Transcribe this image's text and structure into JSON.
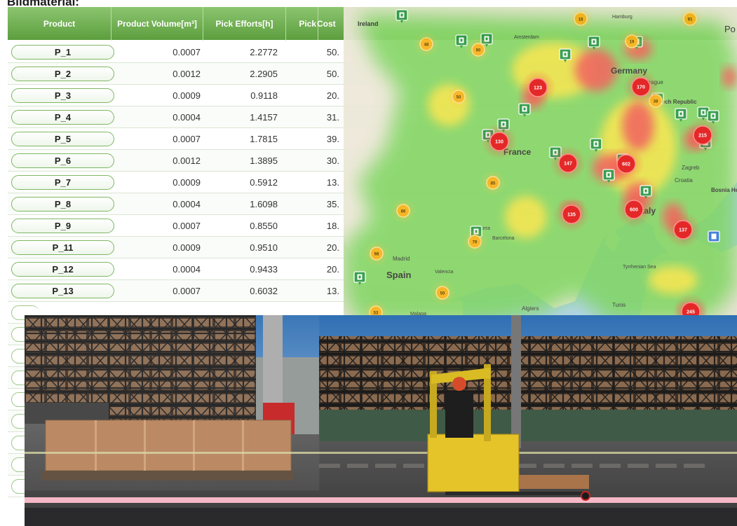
{
  "page": {
    "title": "Bildmaterial:"
  },
  "table": {
    "headers": [
      "Product",
      "Product Volume[m³]",
      "Pick Efforts[h]",
      "Pick",
      "Cost"
    ],
    "rows": [
      {
        "product": "P_1",
        "volume": "0.0007",
        "effort": "2.2772",
        "cost": "50."
      },
      {
        "product": "P_2",
        "volume": "0.0012",
        "effort": "2.2905",
        "cost": "50."
      },
      {
        "product": "P_3",
        "volume": "0.0009",
        "effort": "0.9118",
        "cost": "20."
      },
      {
        "product": "P_4",
        "volume": "0.0004",
        "effort": "1.4157",
        "cost": "31."
      },
      {
        "product": "P_5",
        "volume": "0.0007",
        "effort": "1.7815",
        "cost": "39."
      },
      {
        "product": "P_6",
        "volume": "0.0012",
        "effort": "1.3895",
        "cost": "30."
      },
      {
        "product": "P_7",
        "volume": "0.0009",
        "effort": "0.5912",
        "cost": "13."
      },
      {
        "product": "P_8",
        "volume": "0.0004",
        "effort": "1.6098",
        "cost": "35."
      },
      {
        "product": "P_9",
        "volume": "0.0007",
        "effort": "0.8550",
        "cost": "18."
      },
      {
        "product": "P_11",
        "volume": "0.0009",
        "effort": "0.9510",
        "cost": "20."
      },
      {
        "product": "P_12",
        "volume": "0.0004",
        "effort": "0.9433",
        "cost": "20."
      },
      {
        "product": "P_13",
        "volume": "0.0007",
        "effort": "0.6032",
        "cost": "13."
      }
    ],
    "empty_rows": 9,
    "colors": {
      "header": "#6aaa4b",
      "pill_border": "#7fb764"
    }
  },
  "map": {
    "labels": {
      "ireland": "Ireland",
      "germany": "Germany",
      "france": "France",
      "spain": "Spain",
      "italy": "Italy",
      "barcelona": "Barcelona",
      "prague": "Prague",
      "czech": "Czech Republic",
      "zagreb": "Zagreb",
      "croatia": "Croatia",
      "bosnia": "Bosnia Herzego",
      "tunis": "Tunis",
      "algiers": "Algiers",
      "malaga": "Malaga",
      "valencia": "Valencia",
      "madrid": "Madrid",
      "amsterdam": "Amsterdam",
      "hamburg": "Hamburg",
      "tyrrhenian": "Tyrrhenian Sea",
      "andorra": "Andorra",
      "po": "Po"
    },
    "clusters": [
      {
        "value": "48",
        "level": "orange"
      },
      {
        "value": "90",
        "level": "orange"
      },
      {
        "value": "18",
        "level": "orange"
      },
      {
        "value": "19",
        "level": "orange"
      },
      {
        "value": "91",
        "level": "orange"
      },
      {
        "value": "50",
        "level": "orange"
      },
      {
        "value": "38",
        "level": "orange"
      },
      {
        "value": "85",
        "level": "orange"
      },
      {
        "value": "86",
        "level": "orange"
      },
      {
        "value": "79",
        "level": "orange"
      },
      {
        "value": "98",
        "level": "orange"
      },
      {
        "value": "50",
        "level": "orange"
      },
      {
        "value": "53",
        "level": "orange"
      },
      {
        "value": "123",
        "level": "red"
      },
      {
        "value": "170",
        "level": "red"
      },
      {
        "value": "215",
        "level": "red"
      },
      {
        "value": "130",
        "level": "red"
      },
      {
        "value": "147",
        "level": "red"
      },
      {
        "value": "602",
        "level": "red"
      },
      {
        "value": "135",
        "level": "red"
      },
      {
        "value": "600",
        "level": "red"
      },
      {
        "value": "137",
        "level": "red"
      },
      {
        "value": "245",
        "level": "red"
      }
    ],
    "colors": {
      "heat_green": "#6cd04a",
      "heat_yellow": "#f4e33a",
      "heat_red": "#f0524a",
      "cluster_red": "#e31b1b",
      "cluster_orange": "#f6b31c",
      "marker": "#2e9a45"
    }
  },
  "warehouse": {
    "colors": {
      "sky_top": "#2f6fb3",
      "sky_bottom": "#b9d3ea",
      "floor": "#3b3a3a",
      "rack": "#1c1c1c",
      "box": "#b7835a",
      "forklift": "#e5c42a",
      "stripe": "#f6b8c7"
    }
  }
}
